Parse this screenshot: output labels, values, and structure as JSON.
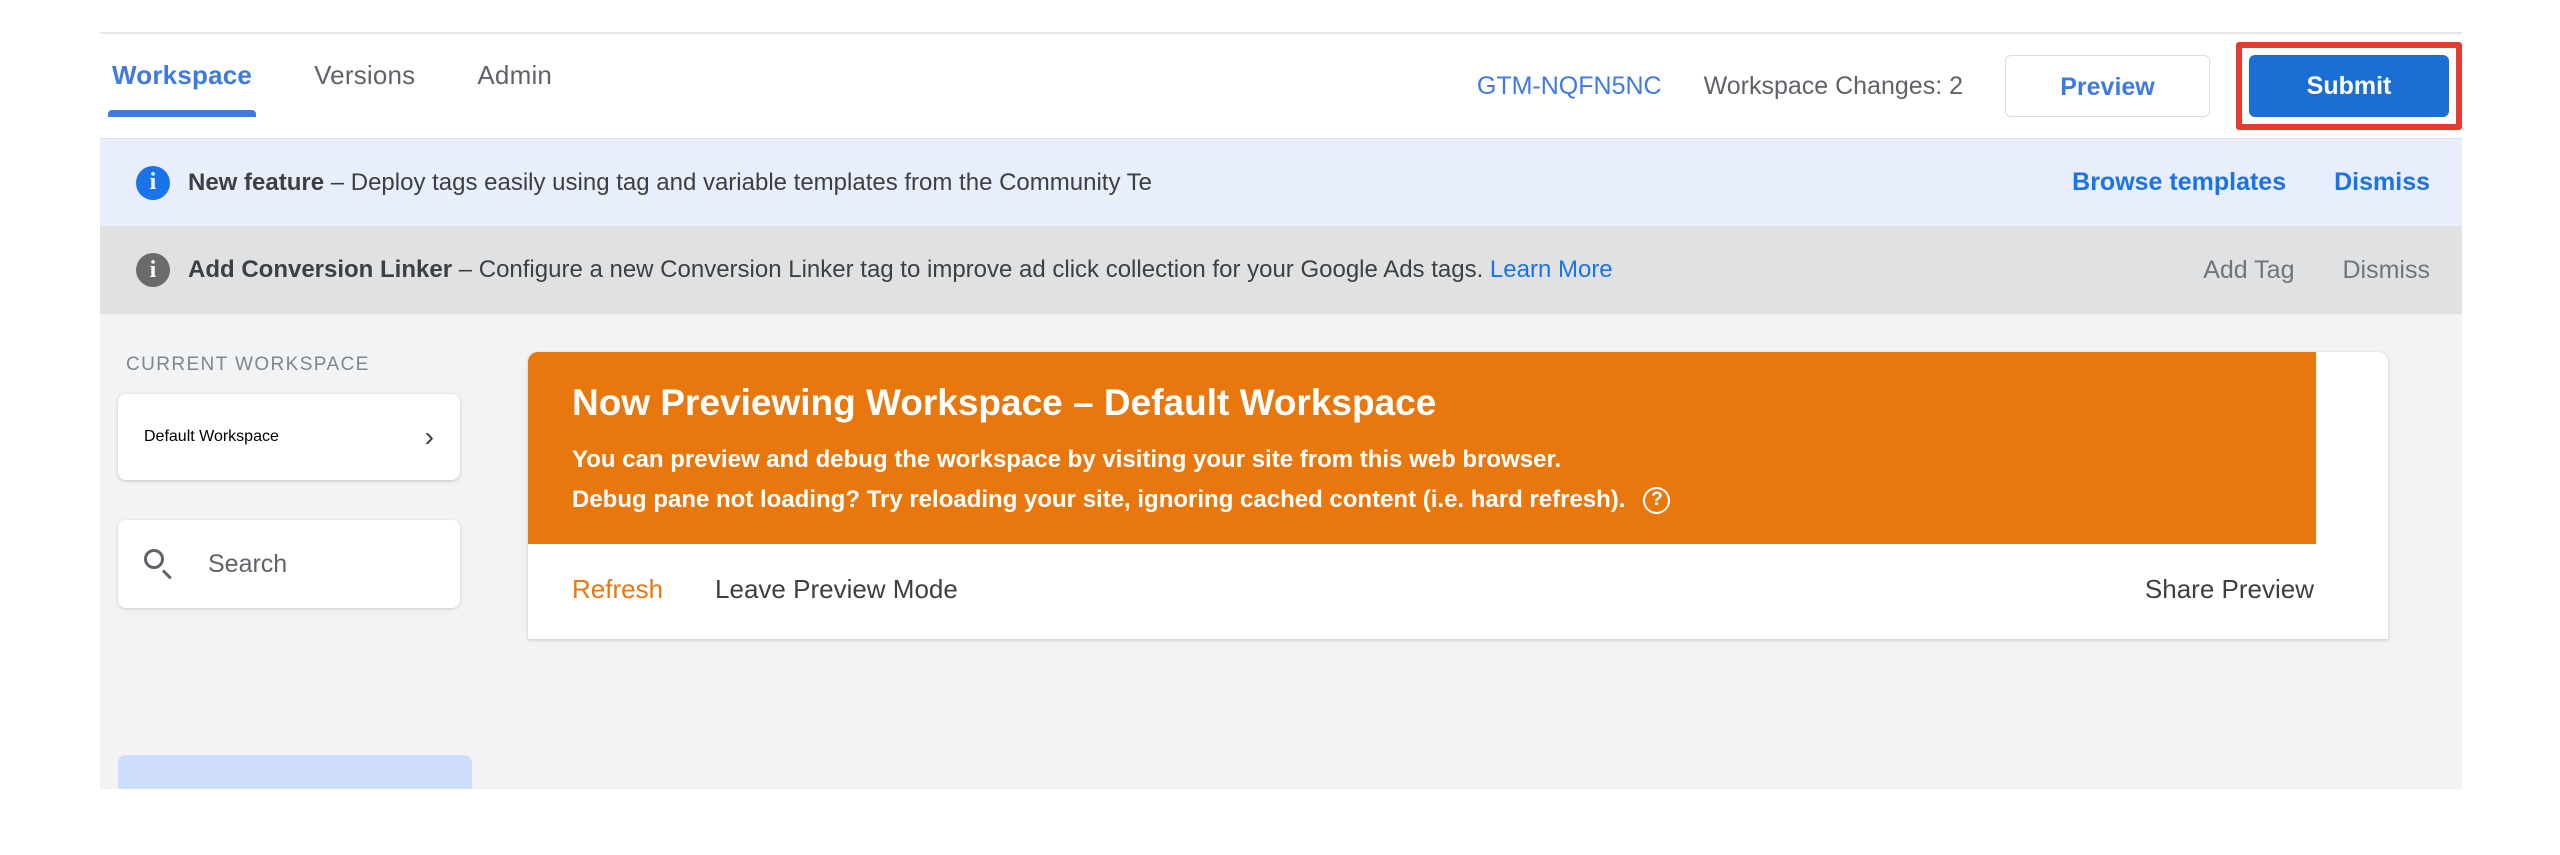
{
  "topbar": {
    "tabs": [
      {
        "label": "Workspace",
        "active": true
      },
      {
        "label": "Versions",
        "active": false
      },
      {
        "label": "Admin",
        "active": false
      }
    ],
    "container_id": "GTM-NQFN5NC",
    "workspace_changes": "Workspace Changes: 2",
    "preview_button": "Preview",
    "submit_button": "Submit",
    "accent_blue": "#3f7ae0",
    "submit_blue": "#1b6fd4",
    "highlight_red": "#e83b2f"
  },
  "banners": [
    {
      "icon": "info-icon",
      "title": "New feature",
      "dash": " – ",
      "message": "Deploy tags easily using tag and variable templates from the Community Te",
      "primary_action": "Browse templates",
      "secondary_action": "Dismiss",
      "background": "#e8eefb"
    },
    {
      "icon": "info-icon",
      "title": "Add Conversion Linker",
      "dash": " – ",
      "message": "Configure a new Conversion Linker tag to improve ad click collection for your Google Ads tags. ",
      "link": "Learn More",
      "primary_action": "Add Tag",
      "secondary_action": "Dismiss",
      "background": "#e0e1e2"
    }
  ],
  "sidebar": {
    "section_label": "CURRENT WORKSPACE",
    "workspace_name": "Default Workspace",
    "chevron": "›",
    "search_placeholder": "Search"
  },
  "preview": {
    "title": "Now Previewing Workspace – Default Workspace",
    "line1": "You can preview and debug the workspace by visiting your site from this web browser.",
    "line2": "Debug pane not loading? Try reloading your site, ignoring cached content (i.e. hard refresh).",
    "help_glyph": "?",
    "refresh_label": "Refresh",
    "leave_label": "Leave Preview Mode",
    "share_label": "Share Preview",
    "orange": "#e8770e"
  }
}
